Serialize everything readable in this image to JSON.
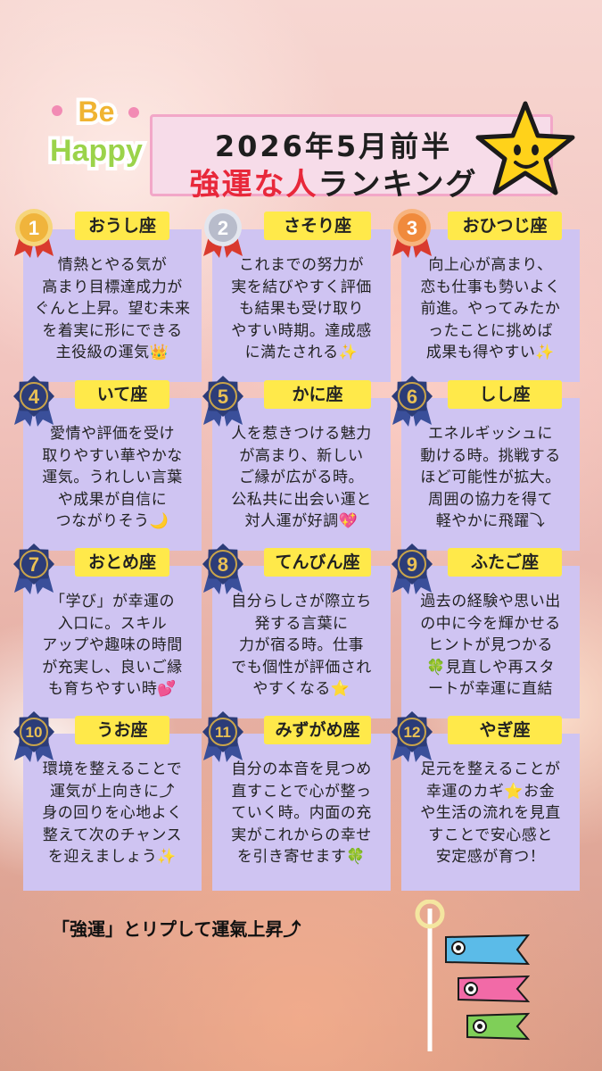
{
  "header": {
    "title_line1": "2026年5月前半",
    "title_line2_red": "強運な人",
    "title_line2_rest": "ランキング",
    "sticker_be": "Be",
    "sticker_happy": "Happy"
  },
  "ranking": [
    {
      "rank": "1",
      "sign": "おうし座",
      "lines": [
        "情熱とやる気が",
        "高まり目標達成力が",
        "ぐんと上昇。望む未来",
        "を着実に形にできる",
        "主役級の運気👑"
      ]
    },
    {
      "rank": "2",
      "sign": "さそり座",
      "lines": [
        "これまでの努力が",
        "実を結びやすく評価",
        "も結果も受け取り",
        "やすい時期。達成感",
        "に満たされる✨"
      ]
    },
    {
      "rank": "3",
      "sign": "おひつじ座",
      "lines": [
        "向上心が高まり、",
        "恋も仕事も勢いよく",
        "前進。やってみたか",
        "ったことに挑めば",
        "成果も得やすい✨"
      ]
    },
    {
      "rank": "4",
      "sign": "いて座",
      "lines": [
        "愛情や評価を受け",
        "取りやすい華やかな",
        "運気。うれしい言葉",
        "や成果が自信に",
        "つながりそう🌙"
      ]
    },
    {
      "rank": "5",
      "sign": "かに座",
      "lines": [
        "人を惹きつける魅力",
        "が高まり、新しい",
        "ご縁が広がる時。",
        "公私共に出会い運と",
        "対人運が好調💖"
      ]
    },
    {
      "rank": "6",
      "sign": "しし座",
      "lines": [
        "エネルギッシュに",
        "動ける時。挑戦する",
        "ほど可能性が拡大。",
        "周囲の協力を得て",
        "軽やかに飛躍⤵"
      ]
    },
    {
      "rank": "7",
      "sign": "おとめ座",
      "lines": [
        "「学び」が幸運の",
        "入口に。スキル",
        "アップや趣味の時間",
        "が充実し、良いご縁",
        "も育ちやすい時💕"
      ]
    },
    {
      "rank": "8",
      "sign": "てんびん座",
      "lines": [
        "自分らしさが際立ち",
        "発する言葉に",
        "力が宿る時。仕事",
        "でも個性が評価され",
        "やすくなる⭐"
      ]
    },
    {
      "rank": "9",
      "sign": "ふたご座",
      "lines": [
        "過去の経験や思い出",
        "の中に今を輝かせる",
        "ヒントが見つかる",
        "🍀見直しや再スタ",
        "ートが幸運に直結"
      ]
    },
    {
      "rank": "10",
      "sign": "うお座",
      "lines": [
        "環境を整えることで",
        "運気が上向きに⤴",
        "身の回りを心地よく",
        "整えて次のチャンス",
        "を迎えましょう✨"
      ]
    },
    {
      "rank": "11",
      "sign": "みずがめ座",
      "lines": [
        "自分の本音を見つめ",
        "直すことで心が整っ",
        "ていく時。内面の充",
        "実がこれからの幸せ",
        "を引き寄せます🍀"
      ]
    },
    {
      "rank": "12",
      "sign": "やぎ座",
      "lines": [
        "足元を整えることが",
        "幸運のカギ⭐お金",
        "や生活の流れを見直",
        "すことで安心感と",
        "安定感が育つ！"
      ]
    }
  ],
  "footer": {
    "text": "「強運」とリプして運氣上昇⤴"
  },
  "colors": {
    "card": "#cfc4f2",
    "label": "#ffe94a",
    "accent_red": "#e8283a",
    "gold": "#f0b43c",
    "silver": "#b8bccb",
    "bronze": "#f08a3c",
    "navy": "#2c3c78"
  }
}
